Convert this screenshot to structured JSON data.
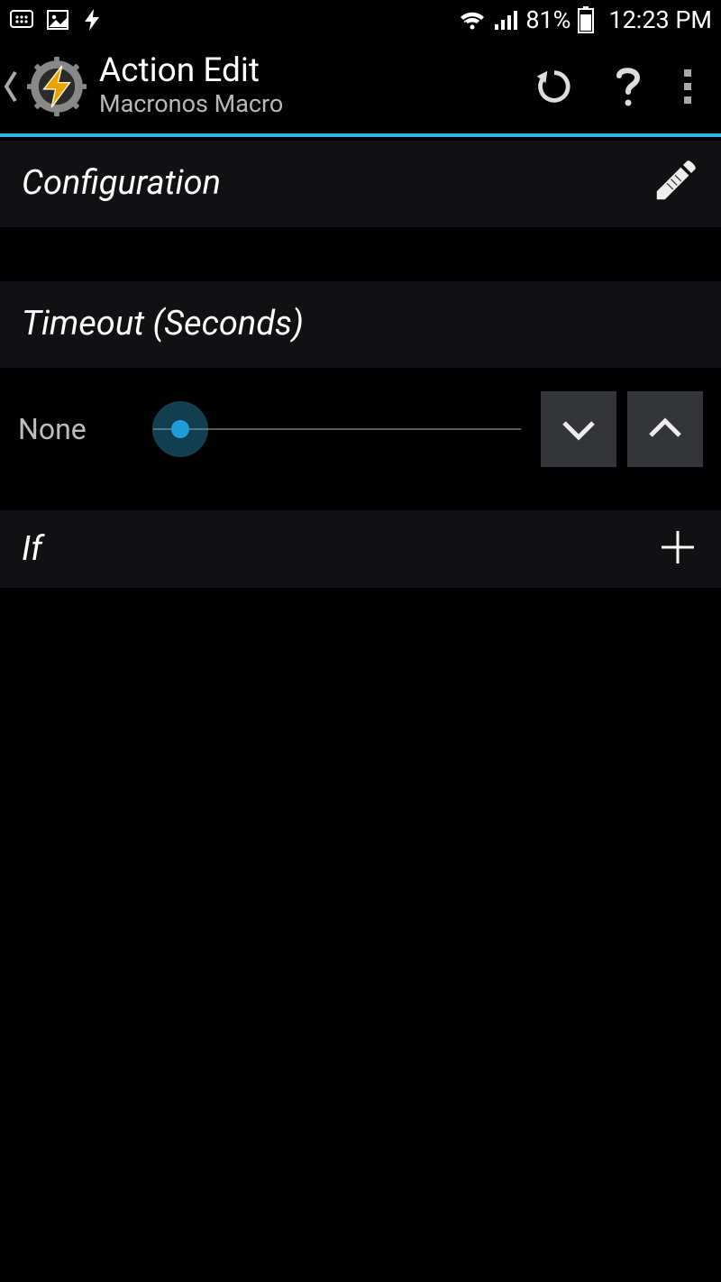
{
  "statusbar": {
    "battery_percent": "81%",
    "time": "12:23 PM"
  },
  "header": {
    "title": "Action Edit",
    "subtitle": "Macronos Macro"
  },
  "sections": {
    "configuration_label": "Configuration",
    "timeout_label": "Timeout (Seconds)",
    "timeout_value": "None",
    "if_label": "If"
  }
}
